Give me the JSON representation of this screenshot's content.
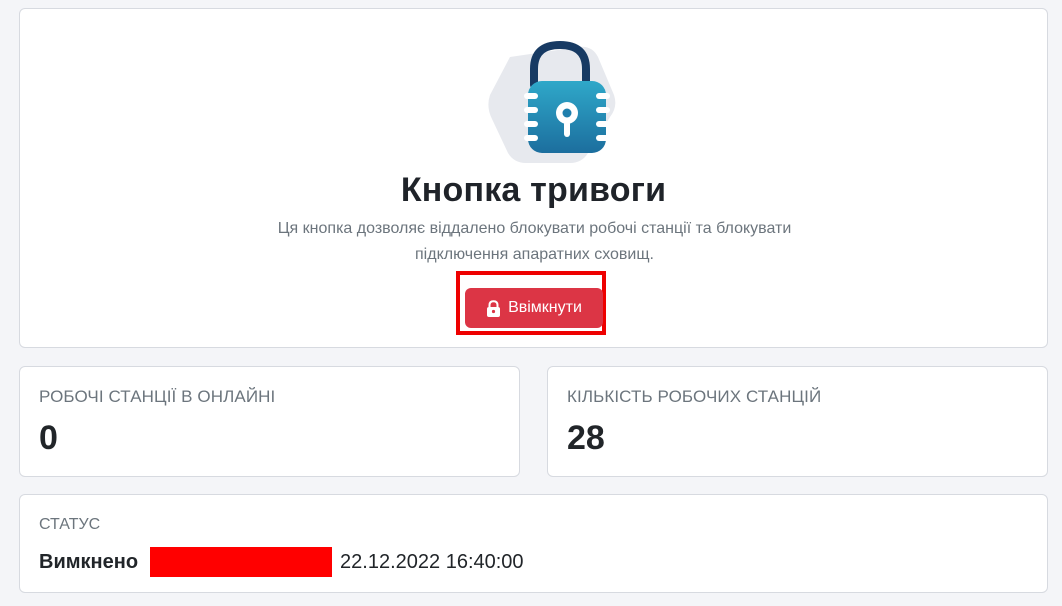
{
  "panic": {
    "title": "Кнопка тривоги",
    "description": "Ця кнопка дозволяє віддалено блокувати робочі станції та блокувати підключення апаратних сховищ.",
    "button_label": "Ввімкнути",
    "button_color": "#dc3545",
    "illustration_icon": "padlock-icon",
    "button_icon": "lock-icon"
  },
  "stats": {
    "online_label": "Робочі станції в онлайні",
    "online_value": "0",
    "total_label": "Кількість робочих станцій",
    "total_value": "28"
  },
  "status": {
    "label": "Статус",
    "state": "Вимкнено",
    "timestamp": "22.12.2022 16:40:00"
  },
  "colors": {
    "page_background": "#f4f5f8",
    "card_background": "#ffffff",
    "highlight_border": "#ee0000",
    "redaction": "#ff0000",
    "muted_text": "#6c757d"
  }
}
